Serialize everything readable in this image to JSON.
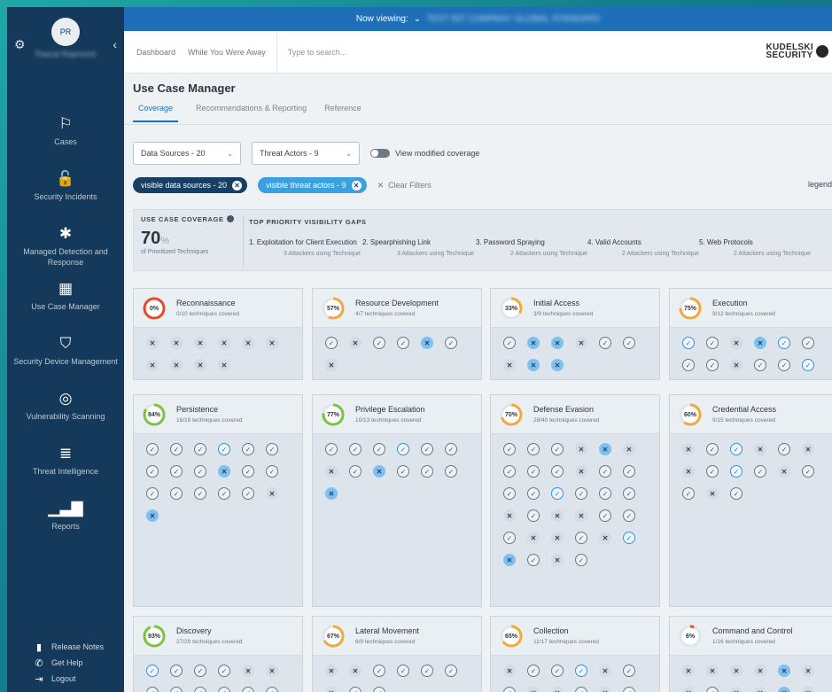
{
  "sidebar": {
    "avatar_initials": "PR",
    "user_name": "Pascal Raymond",
    "items": [
      {
        "label": "Cases",
        "icon": "flag-icon",
        "glyph": "⚐"
      },
      {
        "label": "Security Incidents",
        "icon": "lock-icon",
        "glyph": "🔓"
      },
      {
        "label": "Managed Detection and Response",
        "icon": "asterisk-icon",
        "glyph": "✱"
      },
      {
        "label": "Use Case Manager",
        "icon": "grid-icon",
        "glyph": "▦"
      },
      {
        "label": "Security Device Management",
        "icon": "shield-icon",
        "glyph": "⛉"
      },
      {
        "label": "Vulnerability Scanning",
        "icon": "target-icon",
        "glyph": "◎"
      },
      {
        "label": "Threat Intelligence",
        "icon": "database-icon",
        "glyph": "≣"
      },
      {
        "label": "Reports",
        "icon": "bar-chart-icon",
        "glyph": "▁▃▇"
      }
    ],
    "bottom": [
      {
        "label": "Release Notes",
        "icon": "document-icon",
        "glyph": "▮"
      },
      {
        "label": "Get Help",
        "icon": "phone-icon",
        "glyph": "✆"
      },
      {
        "label": "Logout",
        "icon": "logout-icon",
        "glyph": "⇥"
      }
    ]
  },
  "banner": {
    "prefix": "Now viewing:",
    "company": "TEST INT COMPANY GLOBAL STANDARD"
  },
  "header": {
    "links": [
      "Dashboard",
      "While You Were Away"
    ],
    "search_placeholder": "Type to search...",
    "logo_line1": "KUDELSKI",
    "logo_line2": "SECURITY"
  },
  "page": {
    "title": "Use Case Manager",
    "tabs": [
      "Coverage",
      "Recommendations & Reporting",
      "Reference"
    ],
    "active_tab": 0
  },
  "filters": {
    "data_sources": "Data Sources - 20",
    "threat_actors": "Threat Actors - 9",
    "toggle_label": "View modified coverage",
    "chips": [
      "visible data sources - 20",
      "visible threat actors - 9"
    ],
    "clear_label": "Clear Filters",
    "legend_label": "legend"
  },
  "summary": {
    "coverage_label": "USE CASE COVERAGE",
    "coverage_value": "70",
    "coverage_unit": "%",
    "coverage_sub": "of Prioritized Techniques",
    "gaps_label": "TOP PRIORITY VISIBILITY GAPS",
    "gaps": [
      {
        "title": "1. Exploitation for Client Execution",
        "sub": "3 Attackers using Technique"
      },
      {
        "title": "2. Spearphishing Link",
        "sub": "3 Attackers using Technique"
      },
      {
        "title": "3. Password Spraying",
        "sub": "2 Attackers using Technique"
      },
      {
        "title": "4. Valid Accounts",
        "sub": "2 Attackers using Technique"
      },
      {
        "title": "5. Web Protocols",
        "sub": "2 Attackers using Technique"
      }
    ]
  },
  "colors": {
    "ring_track": "#dfe5eb",
    "ring_red": "#e8492d",
    "ring_orange": "#f2a93b",
    "ring_green": "#7cc243"
  },
  "tactics": [
    {
      "name": "Reconnaissance",
      "sub": "0/10 techniques covered",
      "pct": 0,
      "pct_label": "0%",
      "color": "#e8492d",
      "techs": [
        "x",
        "x",
        "x",
        "x",
        "x",
        "x",
        "x",
        "x",
        "x",
        "x"
      ]
    },
    {
      "name": "Resource Development",
      "sub": "4/7 techniques covered",
      "pct": 57,
      "pct_label": "57%",
      "color": "#f2a93b",
      "techs": [
        "c",
        "x",
        "c",
        "c",
        "X",
        "c",
        "x"
      ]
    },
    {
      "name": "Initial Access",
      "sub": "3/9 techniques covered",
      "pct": 33,
      "pct_label": "33%",
      "color": "#f2a93b",
      "techs": [
        "c",
        "X",
        "X",
        "x",
        "c",
        "c",
        "x",
        "X",
        "X"
      ]
    },
    {
      "name": "Execution",
      "sub": "9/12 techniques covered",
      "pct": 75,
      "pct_label": "75%",
      "color": "#f2a93b",
      "techs": [
        "C",
        "c",
        "x",
        "X",
        "C",
        "c",
        "c",
        "c",
        "x",
        "c",
        "c",
        "C"
      ]
    },
    {
      "name": "Persistence",
      "sub": "16/19 techniques covered",
      "pct": 84,
      "pct_label": "84%",
      "color": "#7cc243",
      "techs": [
        "c",
        "c",
        "c",
        "C",
        "c",
        "c",
        "c",
        "c",
        "c",
        "X",
        "c",
        "c",
        "c",
        "c",
        "c",
        "c",
        "c",
        "x",
        "X"
      ]
    },
    {
      "name": "Privilege Escalation",
      "sub": "10/13 techniques covered",
      "pct": 77,
      "pct_label": "77%",
      "color": "#7cc243",
      "techs": [
        "c",
        "c",
        "c",
        "C",
        "c",
        "c",
        "x",
        "c",
        "X",
        "c",
        "c",
        "c",
        "X"
      ]
    },
    {
      "name": "Defense Evasion",
      "sub": "28/40 techniques covered",
      "pct": 70,
      "pct_label": "70%",
      "color": "#f2a93b",
      "techs": [
        "c",
        "c",
        "c",
        "x",
        "X",
        "x",
        "c",
        "c",
        "c",
        "x",
        "c",
        "c",
        "c",
        "c",
        "C",
        "c",
        "c",
        "c",
        "x",
        "c",
        "x",
        "x",
        "c",
        "c",
        "c",
        "x",
        "x",
        "c",
        "x",
        "C",
        "X",
        "c",
        "x",
        "c"
      ]
    },
    {
      "name": "Credential Access",
      "sub": "9/15 techniques covered",
      "pct": 60,
      "pct_label": "60%",
      "color": "#f2a93b",
      "techs": [
        "x",
        "c",
        "C",
        "x",
        "c",
        "x",
        "x",
        "c",
        "C",
        "c",
        "x",
        "c",
        "c",
        "x",
        "c"
      ]
    },
    {
      "name": "Discovery",
      "sub": "27/29 techniques covered",
      "pct": 93,
      "pct_label": "93%",
      "color": "#7cc243",
      "techs": [
        "C",
        "c",
        "c",
        "c",
        "x",
        "x",
        "c",
        "c",
        "c",
        "c",
        "c",
        "c"
      ]
    },
    {
      "name": "Lateral Movement",
      "sub": "6/9 techniques covered",
      "pct": 67,
      "pct_label": "67%",
      "color": "#f2a93b",
      "techs": [
        "x",
        "x",
        "c",
        "c",
        "c",
        "c",
        "x",
        "c",
        "c"
      ]
    },
    {
      "name": "Collection",
      "sub": "11/17 techniques covered",
      "pct": 65,
      "pct_label": "65%",
      "color": "#f2a93b",
      "techs": [
        "x",
        "c",
        "c",
        "C",
        "x",
        "c",
        "c",
        "x",
        "x",
        "c",
        "x",
        "c"
      ]
    },
    {
      "name": "Command and Control",
      "sub": "1/16 techniques covered",
      "pct": 6,
      "pct_label": "6%",
      "color": "#e8492d",
      "techs": [
        "x",
        "x",
        "x",
        "x",
        "X",
        "x",
        "x",
        "c",
        "x",
        "x",
        "X",
        "x"
      ]
    }
  ]
}
